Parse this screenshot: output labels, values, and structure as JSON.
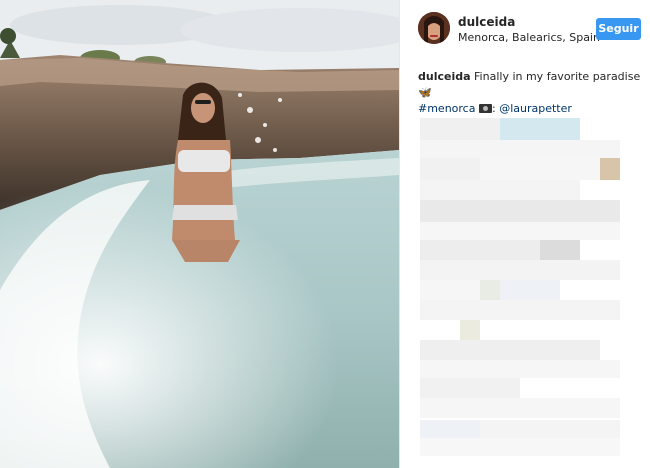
{
  "post": {
    "username": "dulceida",
    "location": "Menorca, Balearics, Spain",
    "follow_label": "Seguir",
    "caption": {
      "username": "dulceida",
      "text": "Finally in my favorite paradise",
      "emoji": "🦋",
      "hashtag": "#menorca",
      "camera_icon": "camera-icon",
      "separator": ":",
      "mention": "@laurapetter"
    }
  },
  "colors": {
    "follow_button": "#3897f0",
    "link": "#003569",
    "text": "#262626"
  }
}
